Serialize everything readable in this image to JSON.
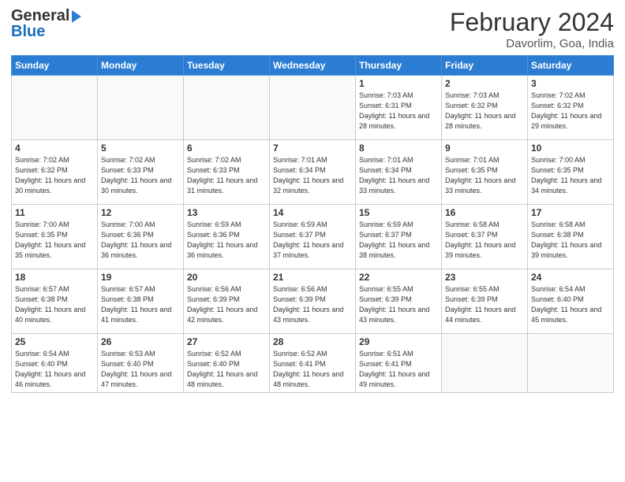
{
  "header": {
    "logo_general": "General",
    "logo_blue": "Blue",
    "title": "February 2024",
    "location": "Davorlim, Goa, India"
  },
  "weekdays": [
    "Sunday",
    "Monday",
    "Tuesday",
    "Wednesday",
    "Thursday",
    "Friday",
    "Saturday"
  ],
  "weeks": [
    [
      {
        "day": "",
        "info": ""
      },
      {
        "day": "",
        "info": ""
      },
      {
        "day": "",
        "info": ""
      },
      {
        "day": "",
        "info": ""
      },
      {
        "day": "1",
        "info": "Sunrise: 7:03 AM\nSunset: 6:31 PM\nDaylight: 11 hours and 28 minutes."
      },
      {
        "day": "2",
        "info": "Sunrise: 7:03 AM\nSunset: 6:32 PM\nDaylight: 11 hours and 28 minutes."
      },
      {
        "day": "3",
        "info": "Sunrise: 7:02 AM\nSunset: 6:32 PM\nDaylight: 11 hours and 29 minutes."
      }
    ],
    [
      {
        "day": "4",
        "info": "Sunrise: 7:02 AM\nSunset: 6:32 PM\nDaylight: 11 hours and 30 minutes."
      },
      {
        "day": "5",
        "info": "Sunrise: 7:02 AM\nSunset: 6:33 PM\nDaylight: 11 hours and 30 minutes."
      },
      {
        "day": "6",
        "info": "Sunrise: 7:02 AM\nSunset: 6:33 PM\nDaylight: 11 hours and 31 minutes."
      },
      {
        "day": "7",
        "info": "Sunrise: 7:01 AM\nSunset: 6:34 PM\nDaylight: 11 hours and 32 minutes."
      },
      {
        "day": "8",
        "info": "Sunrise: 7:01 AM\nSunset: 6:34 PM\nDaylight: 11 hours and 33 minutes."
      },
      {
        "day": "9",
        "info": "Sunrise: 7:01 AM\nSunset: 6:35 PM\nDaylight: 11 hours and 33 minutes."
      },
      {
        "day": "10",
        "info": "Sunrise: 7:00 AM\nSunset: 6:35 PM\nDaylight: 11 hours and 34 minutes."
      }
    ],
    [
      {
        "day": "11",
        "info": "Sunrise: 7:00 AM\nSunset: 6:35 PM\nDaylight: 11 hours and 35 minutes."
      },
      {
        "day": "12",
        "info": "Sunrise: 7:00 AM\nSunset: 6:36 PM\nDaylight: 11 hours and 36 minutes."
      },
      {
        "day": "13",
        "info": "Sunrise: 6:59 AM\nSunset: 6:36 PM\nDaylight: 11 hours and 36 minutes."
      },
      {
        "day": "14",
        "info": "Sunrise: 6:59 AM\nSunset: 6:37 PM\nDaylight: 11 hours and 37 minutes."
      },
      {
        "day": "15",
        "info": "Sunrise: 6:59 AM\nSunset: 6:37 PM\nDaylight: 11 hours and 38 minutes."
      },
      {
        "day": "16",
        "info": "Sunrise: 6:58 AM\nSunset: 6:37 PM\nDaylight: 11 hours and 39 minutes."
      },
      {
        "day": "17",
        "info": "Sunrise: 6:58 AM\nSunset: 6:38 PM\nDaylight: 11 hours and 39 minutes."
      }
    ],
    [
      {
        "day": "18",
        "info": "Sunrise: 6:57 AM\nSunset: 6:38 PM\nDaylight: 11 hours and 40 minutes."
      },
      {
        "day": "19",
        "info": "Sunrise: 6:57 AM\nSunset: 6:38 PM\nDaylight: 11 hours and 41 minutes."
      },
      {
        "day": "20",
        "info": "Sunrise: 6:56 AM\nSunset: 6:39 PM\nDaylight: 11 hours and 42 minutes."
      },
      {
        "day": "21",
        "info": "Sunrise: 6:56 AM\nSunset: 6:39 PM\nDaylight: 11 hours and 43 minutes."
      },
      {
        "day": "22",
        "info": "Sunrise: 6:55 AM\nSunset: 6:39 PM\nDaylight: 11 hours and 43 minutes."
      },
      {
        "day": "23",
        "info": "Sunrise: 6:55 AM\nSunset: 6:39 PM\nDaylight: 11 hours and 44 minutes."
      },
      {
        "day": "24",
        "info": "Sunrise: 6:54 AM\nSunset: 6:40 PM\nDaylight: 11 hours and 45 minutes."
      }
    ],
    [
      {
        "day": "25",
        "info": "Sunrise: 6:54 AM\nSunset: 6:40 PM\nDaylight: 11 hours and 46 minutes."
      },
      {
        "day": "26",
        "info": "Sunrise: 6:53 AM\nSunset: 6:40 PM\nDaylight: 11 hours and 47 minutes."
      },
      {
        "day": "27",
        "info": "Sunrise: 6:52 AM\nSunset: 6:40 PM\nDaylight: 11 hours and 48 minutes."
      },
      {
        "day": "28",
        "info": "Sunrise: 6:52 AM\nSunset: 6:41 PM\nDaylight: 11 hours and 48 minutes."
      },
      {
        "day": "29",
        "info": "Sunrise: 6:51 AM\nSunset: 6:41 PM\nDaylight: 11 hours and 49 minutes."
      },
      {
        "day": "",
        "info": ""
      },
      {
        "day": "",
        "info": ""
      }
    ]
  ]
}
